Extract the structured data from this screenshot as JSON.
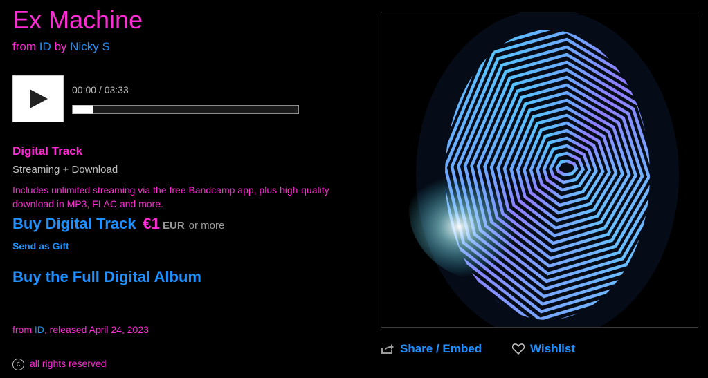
{
  "track": {
    "title": "Ex Machine",
    "from_label": "from",
    "album": "ID",
    "by_label": "by",
    "artist": "Nicky S"
  },
  "player": {
    "time": "00:00 / 03:33",
    "progress": 0.0,
    "icon": "play-icon"
  },
  "purchase": {
    "heading": "Digital Track",
    "format": "Streaming + Download",
    "description": "Includes unlimited streaming via the free Bandcamp app, plus high-quality download in MP3, FLAC and more.",
    "buy_label": "Buy Digital Track",
    "price": "€1",
    "currency": "EUR",
    "or_more": "or more",
    "gift_label": "Send as Gift",
    "full_album_label": "Buy the Full Digital Album"
  },
  "release": {
    "from_label": "from",
    "album": "ID",
    "released_text": ", released April 24, 2023"
  },
  "rights": {
    "icon": "copyright-icon",
    "text": "all rights reserved"
  },
  "actions": {
    "share_label": "Share / Embed",
    "share_icon": "share-icon",
    "wishlist_label": "Wishlist",
    "wishlist_icon": "heart-icon"
  },
  "colors": {
    "accent_pink": "#ff2bd6",
    "link_blue": "#1e90ff",
    "background": "#000000",
    "muted": "#bfbfbf"
  }
}
